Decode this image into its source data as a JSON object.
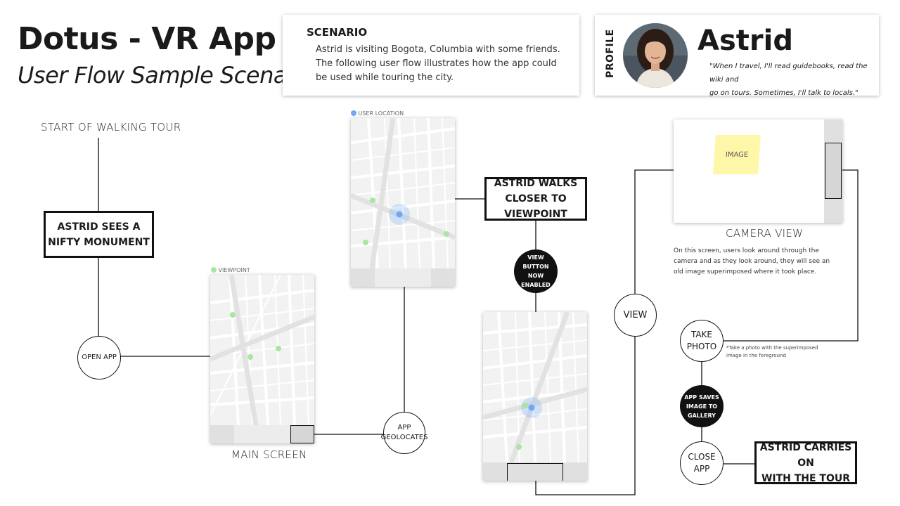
{
  "header": {
    "title": "Dotus - VR App",
    "subtitle": "User Flow Sample Scenario"
  },
  "scenario": {
    "heading": "SCENARIO",
    "lines": [
      "Astrid is visiting Bogota, Columbia with some friends.",
      "The following user flow illustrates how the app could",
      "be used while touring the city."
    ]
  },
  "profile": {
    "label": "PROFILE",
    "name": "Astrid",
    "quote_lines": [
      "\"When I travel, I'll read guidebooks, read the wiki and",
      "go on tours. Sometimes, I'll talk to locals.\""
    ]
  },
  "flow": {
    "start": "START OF WALKING TOUR",
    "sees_monument": [
      "ASTRID SEES A",
      "NIFTY MONUMENT"
    ],
    "open_app": "OPEN APP",
    "viewpoint_legend": "VIEWPOINT",
    "main_screen": "MAIN SCREEN",
    "geolocates": [
      "APP",
      "GEOLOCATES"
    ],
    "user_location_legend": "USER LOCATION",
    "walks_closer": [
      "ASTRID WALKS",
      "CLOSER TO VIEWPOINT"
    ],
    "view_enabled": [
      "VIEW",
      "BUTTON NOW",
      "ENABLED"
    ],
    "view": "VIEW",
    "image_label": "IMAGE",
    "camera_view": "CAMERA VIEW",
    "camera_note_lines": [
      "On this screen, users look around through the",
      "camera and as they look around, they will see an",
      "old image superimposed where it took place."
    ],
    "take_photo": [
      "TAKE",
      "PHOTO"
    ],
    "photo_note_lines": [
      "*Take a photo with the superimposed",
      "image in the foreground"
    ],
    "saves_gallery": [
      "APP SAVES",
      "IMAGE TO",
      "GALLERY"
    ],
    "close_app": [
      "CLOSE",
      "APP"
    ],
    "carries_on": [
      "ASTRID CARRIES ON",
      "WITH THE TOUR"
    ]
  },
  "colors": {
    "viewpoint": "#a8e6a1",
    "user_location": "#6fa8f5",
    "map_bg": "#f2f2f2",
    "map_street": "#ffffff",
    "sticky_note": "#fff7a8",
    "border": "#111111"
  }
}
